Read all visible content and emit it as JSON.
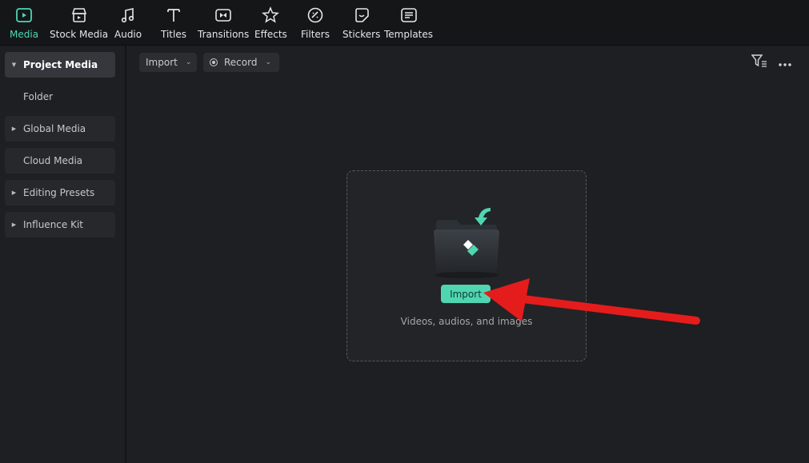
{
  "toolbar": {
    "items": [
      {
        "label": "Media",
        "icon": "media-icon",
        "active": true
      },
      {
        "label": "Stock Media",
        "icon": "stock-media-icon"
      },
      {
        "label": "Audio",
        "icon": "audio-icon"
      },
      {
        "label": "Titles",
        "icon": "titles-icon"
      },
      {
        "label": "Transitions",
        "icon": "transitions-icon"
      },
      {
        "label": "Effects",
        "icon": "effects-icon"
      },
      {
        "label": "Filters",
        "icon": "filters-icon"
      },
      {
        "label": "Stickers",
        "icon": "stickers-icon"
      },
      {
        "label": "Templates",
        "icon": "templates-icon"
      }
    ],
    "accent": "#49d8b5"
  },
  "sidebar": {
    "items": [
      {
        "label": "Project Media",
        "caret": true,
        "active": true
      },
      {
        "label": "Folder"
      },
      {
        "label": "Global Media",
        "caret": true
      },
      {
        "label": "Cloud Media"
      },
      {
        "label": "Editing Presets",
        "caret": true
      },
      {
        "label": "Influence Kit",
        "caret": true
      }
    ]
  },
  "main": {
    "import_dropdown": "Import",
    "record_dropdown": "Record",
    "filter_icon": "filter-icon",
    "more_icon": "more-options-icon",
    "dropzone": {
      "button_label": "Import",
      "hint": "Videos, audios, and images"
    }
  },
  "annotation": {
    "color": "#e51c1c"
  }
}
